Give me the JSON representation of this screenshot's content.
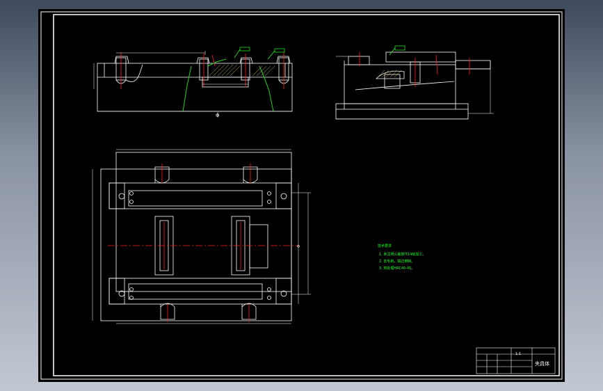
{
  "viewport": {
    "background": "#000000"
  },
  "colors": {
    "outline": "#ffffff",
    "centerline": "#ff2020",
    "dimension": "#ffffff",
    "section_hatch": "#20d020",
    "note_text": "#20ff20",
    "callout": "#20ff20"
  },
  "views": {
    "front": {
      "section_mark": "Φ"
    },
    "plan": {
      "center_mark": "Φ"
    }
  },
  "title_block": {
    "drawing_name": "夹具体",
    "scale": "1:1"
  },
  "notes": {
    "heading": "技术要求",
    "items": [
      "1. 未注明公差按IT14级加工。",
      "2. 去毛刺，锐边倒钝。",
      "3. 热处理HRC40-45。"
    ]
  }
}
